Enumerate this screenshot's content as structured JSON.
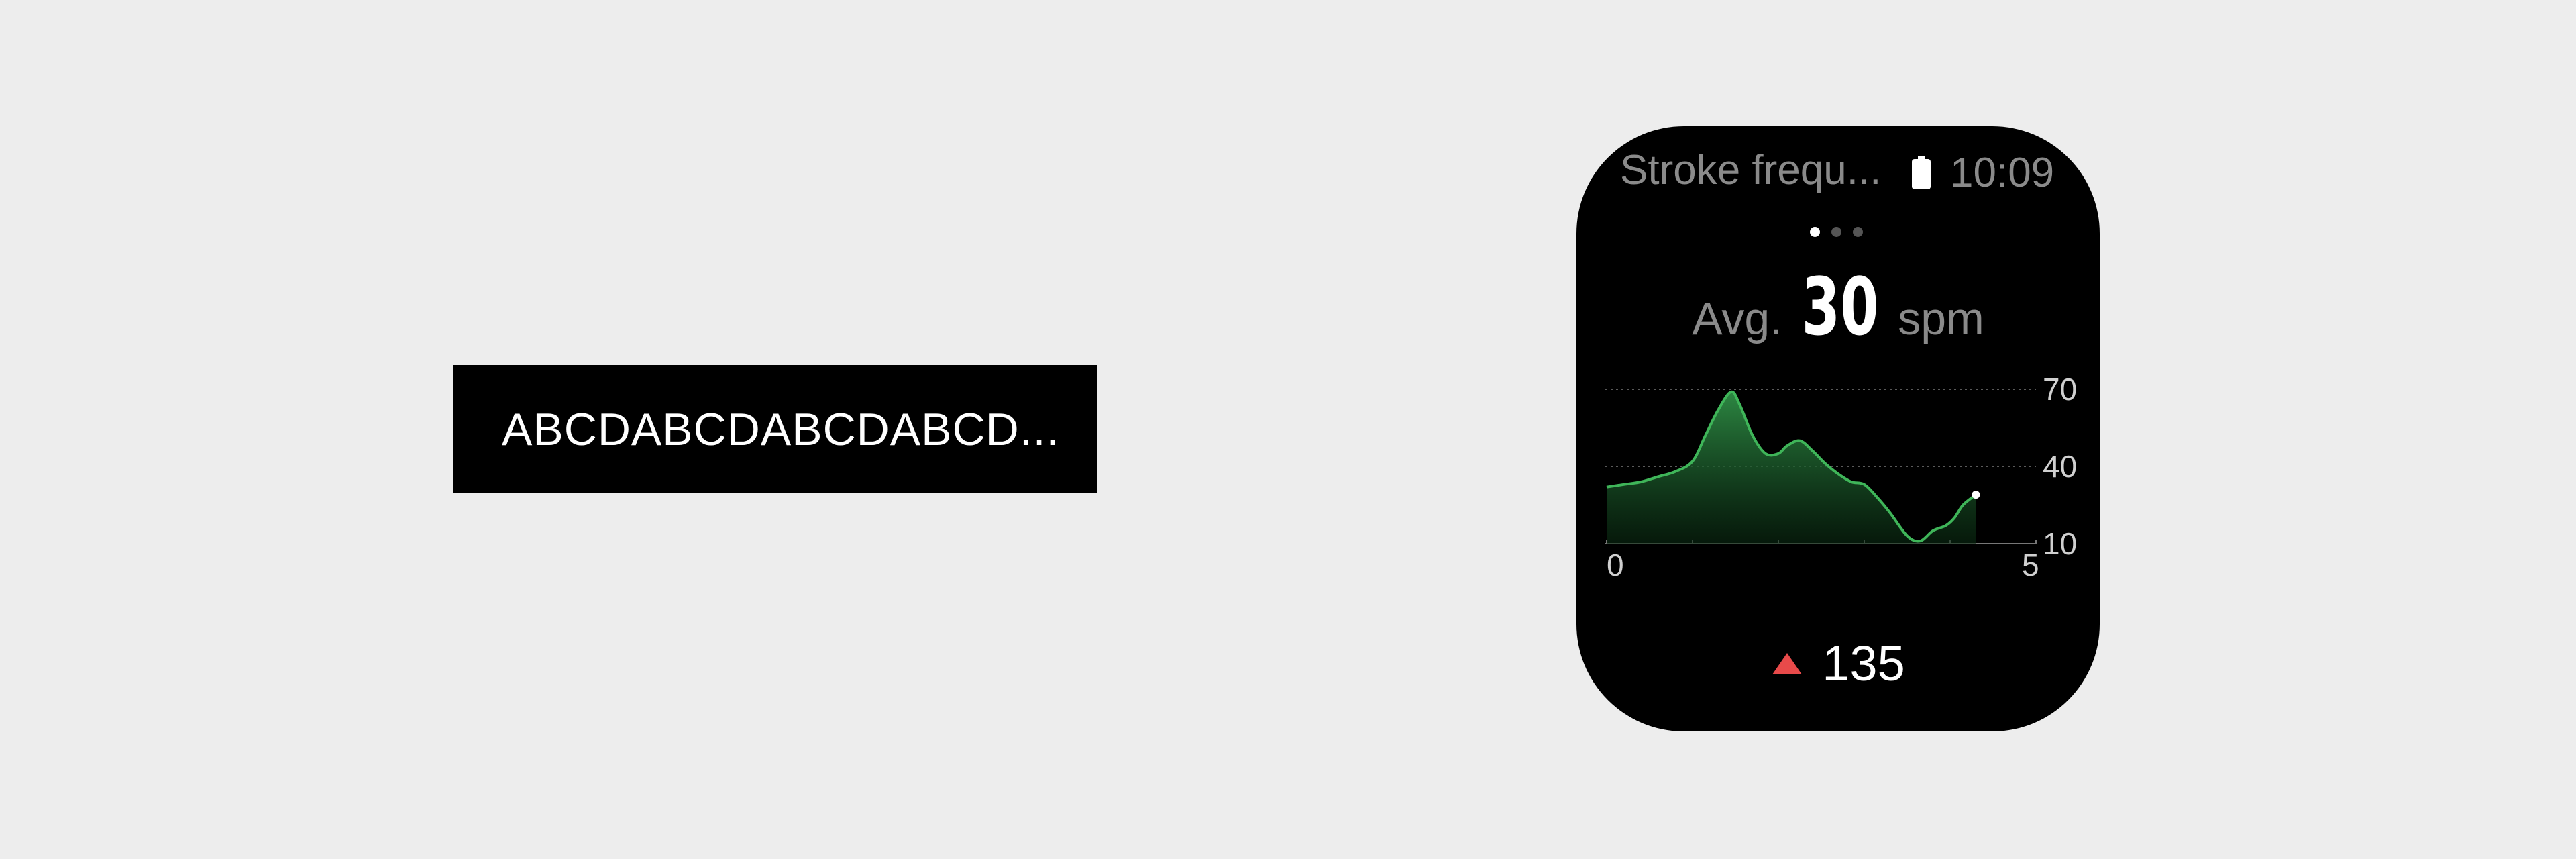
{
  "text_box": {
    "text": "ABCDABCDABCDABCD..."
  },
  "watch": {
    "status": {
      "title": "Stroke frequ...",
      "time": "10:09",
      "battery_icon": "battery-icon"
    },
    "page_indicator": {
      "count": 3,
      "active_index": 0
    },
    "avg": {
      "label": "Avg.",
      "value": "30",
      "unit": "spm"
    },
    "max": {
      "icon": "triangle-up-icon",
      "value": "135",
      "icon_color": "#e84a4a"
    }
  },
  "chart_data": {
    "type": "area",
    "x_ticks": [
      "0",
      "5"
    ],
    "y_ticks": [
      "70",
      "40",
      "10"
    ],
    "xlim": [
      0,
      5
    ],
    "ylim": [
      10,
      70
    ],
    "grid": "dashed horizontal at 70 and 40",
    "series": [
      {
        "color": "#3fb559",
        "x": [
          0,
          0.2,
          0.4,
          0.6,
          0.8,
          1.0,
          1.15,
          1.3,
          1.45,
          1.55,
          1.7,
          1.85,
          2.0,
          2.1,
          2.25,
          2.4,
          2.55,
          2.7,
          2.85,
          3.0,
          3.15,
          3.3,
          3.5,
          3.65,
          3.8,
          3.95,
          4.05,
          4.15,
          4.3
        ],
        "y": [
          32,
          33,
          34,
          36,
          38,
          42,
          52,
          62,
          69,
          64,
          52,
          45,
          45,
          48,
          50,
          46,
          41,
          37,
          34,
          33,
          28,
          22,
          13,
          11,
          15,
          17,
          20,
          25,
          29
        ]
      }
    ],
    "end_marker": {
      "x": 4.3,
      "y": 29
    }
  }
}
